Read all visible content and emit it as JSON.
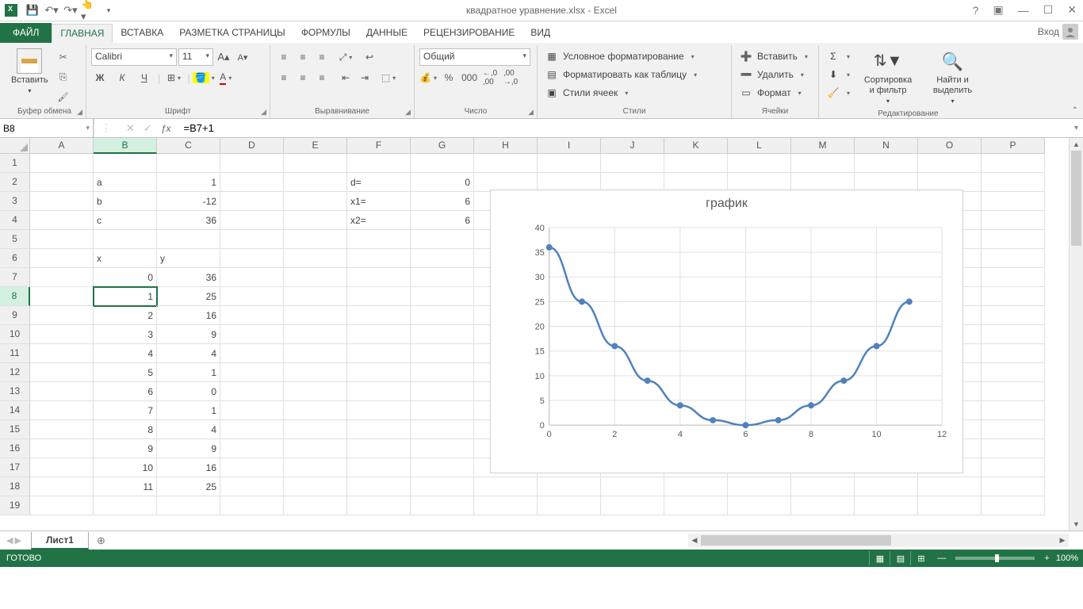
{
  "title": "квадратное уравнение.xlsx - Excel",
  "signin_text": "Вход",
  "tabs": {
    "file": "ФАЙЛ",
    "items": [
      "ГЛАВНАЯ",
      "ВСТАВКА",
      "РАЗМЕТКА СТРАНИЦЫ",
      "ФОРМУЛЫ",
      "ДАННЫЕ",
      "РЕЦЕНЗИРОВАНИЕ",
      "ВИД"
    ],
    "active_index": 0
  },
  "ribbon": {
    "clipboard": {
      "label": "Буфер обмена",
      "paste": "Вставить"
    },
    "font": {
      "label": "Шрифт",
      "name": "Calibri",
      "size": "11",
      "bold": "Ж",
      "italic": "К",
      "underline": "Ч"
    },
    "alignment": {
      "label": "Выравнивание"
    },
    "number": {
      "label": "Число",
      "format": "Общий"
    },
    "styles": {
      "label": "Стили",
      "conditional": "Условное форматирование",
      "table": "Форматировать как таблицу",
      "cell": "Стили ячеек"
    },
    "cells": {
      "label": "Ячейки",
      "insert": "Вставить",
      "delete": "Удалить",
      "format": "Формат"
    },
    "editing": {
      "label": "Редактирование",
      "sort": "Сортировка\nи фильтр",
      "find": "Найти и\nвыделить"
    }
  },
  "namebox": "B8",
  "formula": "=B7+1",
  "columns": [
    "A",
    "B",
    "C",
    "D",
    "E",
    "F",
    "G",
    "H",
    "I",
    "J",
    "K",
    "L",
    "M",
    "N",
    "O",
    "P"
  ],
  "rows": [
    1,
    2,
    3,
    4,
    5,
    6,
    7,
    8,
    9,
    10,
    11,
    12,
    13,
    14,
    15,
    16,
    17,
    18,
    19
  ],
  "active_col_index": 1,
  "active_row_index": 7,
  "cell_data": {
    "2": {
      "B": "a",
      "C": {
        "v": "1",
        "r": true
      },
      "F": "d=",
      "G": {
        "v": "0",
        "r": true
      }
    },
    "3": {
      "B": "b",
      "C": {
        "v": "-12",
        "r": true
      },
      "F": "x1=",
      "G": {
        "v": "6",
        "r": true
      }
    },
    "4": {
      "B": "c",
      "C": {
        "v": "36",
        "r": true
      },
      "F": "x2=",
      "G": {
        "v": "6",
        "r": true
      }
    },
    "6": {
      "B": "x",
      "C": "y"
    },
    "7": {
      "B": {
        "v": "0",
        "r": true
      },
      "C": {
        "v": "36",
        "r": true
      }
    },
    "8": {
      "B": {
        "v": "1",
        "r": true
      },
      "C": {
        "v": "25",
        "r": true
      }
    },
    "9": {
      "B": {
        "v": "2",
        "r": true
      },
      "C": {
        "v": "16",
        "r": true
      }
    },
    "10": {
      "B": {
        "v": "3",
        "r": true
      },
      "C": {
        "v": "9",
        "r": true
      }
    },
    "11": {
      "B": {
        "v": "4",
        "r": true
      },
      "C": {
        "v": "4",
        "r": true
      }
    },
    "12": {
      "B": {
        "v": "5",
        "r": true
      },
      "C": {
        "v": "1",
        "r": true
      }
    },
    "13": {
      "B": {
        "v": "6",
        "r": true
      },
      "C": {
        "v": "0",
        "r": true
      }
    },
    "14": {
      "B": {
        "v": "7",
        "r": true
      },
      "C": {
        "v": "1",
        "r": true
      }
    },
    "15": {
      "B": {
        "v": "8",
        "r": true
      },
      "C": {
        "v": "4",
        "r": true
      }
    },
    "16": {
      "B": {
        "v": "9",
        "r": true
      },
      "C": {
        "v": "9",
        "r": true
      }
    },
    "17": {
      "B": {
        "v": "10",
        "r": true
      },
      "C": {
        "v": "16",
        "r": true
      }
    },
    "18": {
      "B": {
        "v": "11",
        "r": true
      },
      "C": {
        "v": "25",
        "r": true
      }
    }
  },
  "sheet_tab": "Лист1",
  "status": "ГОТОВО",
  "zoom": "100%",
  "chart_data": {
    "type": "line",
    "title": "график",
    "x": [
      0,
      1,
      2,
      3,
      4,
      5,
      6,
      7,
      8,
      9,
      10,
      11
    ],
    "values": [
      36,
      25,
      16,
      9,
      4,
      1,
      0,
      1,
      4,
      9,
      16,
      25
    ],
    "x_ticks": [
      0,
      2,
      4,
      6,
      8,
      10,
      12
    ],
    "y_ticks": [
      0,
      5,
      10,
      15,
      20,
      25,
      30,
      35,
      40
    ],
    "xlim": [
      0,
      12
    ],
    "ylim": [
      0,
      40
    ]
  }
}
